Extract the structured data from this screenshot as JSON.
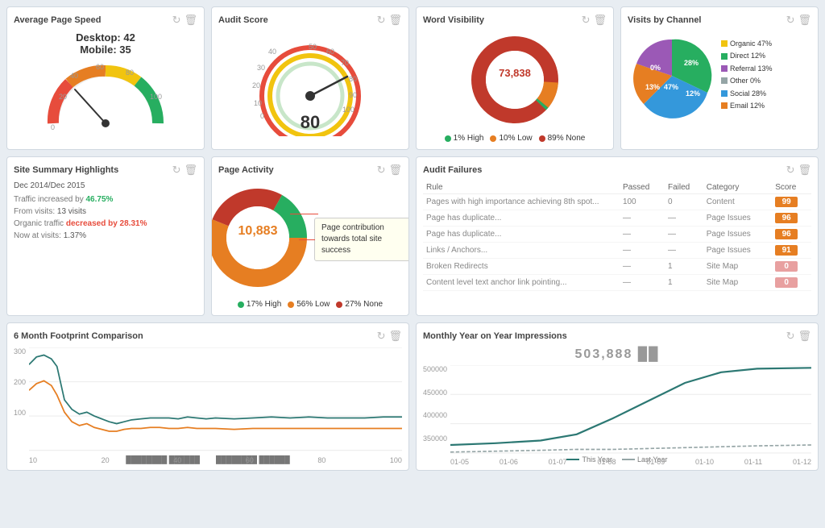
{
  "widgets": {
    "avg_speed": {
      "title": "Average Page Speed",
      "desktop_label": "Desktop: 42",
      "mobile_label": "Mobile: 35",
      "desktop_value": 42,
      "mobile_value": 35
    },
    "audit_score": {
      "title": "Audit Score",
      "value": "80"
    },
    "word_visibility": {
      "title": "Word Visibility",
      "center_value": "73,838",
      "legend": [
        {
          "label": "1% High",
          "color": "#27ae60"
        },
        {
          "label": "10% Low",
          "color": "#e67e22"
        },
        {
          "label": "89% None",
          "color": "#c0392b"
        }
      ]
    },
    "visits_channel": {
      "title": "Visits by Channel",
      "legend": [
        {
          "label": "Organic",
          "color": "#27ae60",
          "pct": "47%"
        },
        {
          "label": "Direct",
          "color": "#e67e22",
          "pct": "12%"
        },
        {
          "label": "Referral",
          "color": "#9b59b6",
          "pct": "13%"
        },
        {
          "label": "Other",
          "color": "#95a5a6",
          "pct": "0%"
        },
        {
          "label": "Social",
          "color": "#3498db",
          "pct": "28%"
        },
        {
          "label": "Email",
          "color": "#f1c40f",
          "pct": "12%"
        }
      ]
    },
    "site_summary": {
      "title": "Site Summary Highlights",
      "date_range": "Dec 2014/Dec 2015",
      "rows": [
        {
          "text": "Traffic increased by ",
          "highlight": "46.75%",
          "type": "green",
          "suffix": ""
        },
        {
          "text": "From visits:",
          "highlight": "13 visits",
          "type": "neutral",
          "suffix": ""
        },
        {
          "text": "Organic traffic decreased by",
          "highlight": "28.31%",
          "type": "red",
          "suffix": ""
        },
        {
          "text": "Now at visits:",
          "highlight": "1.37%",
          "type": "neutral",
          "suffix": ""
        }
      ]
    },
    "page_activity": {
      "title": "Page Activity",
      "center_value": "10,883",
      "legend": [
        {
          "label": "17% High",
          "color": "#27ae60"
        },
        {
          "label": "56% Low",
          "color": "#e67e22"
        },
        {
          "label": "27% None",
          "color": "#c0392b"
        }
      ],
      "tooltip": "Page contribution towards total site success"
    },
    "audit_failures": {
      "title": "Audit Failures",
      "columns": [
        "Rule",
        "Passed",
        "Failed",
        "Category",
        "Score"
      ],
      "rows": [
        {
          "rule": "Pages with high importance achieving 8th spot...",
          "passed": "100",
          "failed": "0",
          "category": "Content",
          "score": 99,
          "score_type": "orange"
        },
        {
          "rule": "Page has duplicate...",
          "passed": "—",
          "failed": "—",
          "category": "Page Issues",
          "score": 96,
          "score_type": "orange"
        },
        {
          "rule": "Page has duplicate...",
          "passed": "—",
          "failed": "—",
          "category": "Page Issues",
          "score": 96,
          "score_type": "orange"
        },
        {
          "rule": "Links / Anchors...",
          "passed": "—",
          "failed": "—",
          "category": "Page Issues",
          "score": 91,
          "score_type": "orange"
        },
        {
          "rule": "Broken Redirects",
          "passed": "—",
          "failed": "1",
          "category": "Site Map",
          "score": 0,
          "score_type": "pink"
        },
        {
          "rule": "Content level text anchor link pointing pointing...",
          "passed": "—",
          "failed": "1",
          "category": "Site Map",
          "score": 0,
          "score_type": "pink"
        }
      ]
    },
    "footprint": {
      "title": "6 Month Footprint Comparison",
      "y_labels": [
        "300",
        "200",
        "100"
      ],
      "x_labels": [
        "10",
        "20",
        "40",
        "60",
        "80",
        "100"
      ],
      "bottom_labels": [
        "label1",
        "label2"
      ]
    },
    "impressions": {
      "title": "Monthly Year on Year Impressions",
      "center_value": "503,888",
      "y_labels": [
        "500000",
        "450000",
        "400000",
        "350000"
      ],
      "x_labels": [
        "01-05",
        "01-06",
        "01-07",
        "01-08",
        "01-09",
        "01-10",
        "01-11",
        "01-12"
      ],
      "legend": [
        "This Year",
        "Last Year"
      ]
    }
  },
  "icons": {
    "refresh": "↻",
    "trash": "🗑"
  }
}
